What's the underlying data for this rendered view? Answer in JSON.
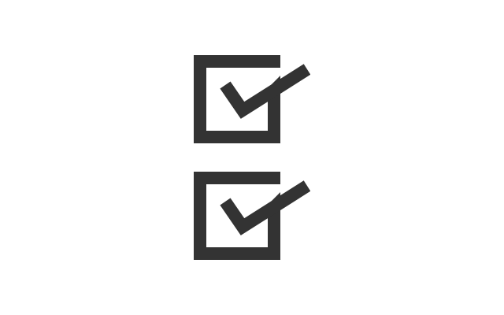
{
  "icons": [
    {
      "name": "checked-checkbox-icon",
      "checked": true
    },
    {
      "name": "checked-checkbox-icon",
      "checked": true
    }
  ],
  "colors": {
    "background": "#ffffff",
    "icon": "#333333"
  }
}
